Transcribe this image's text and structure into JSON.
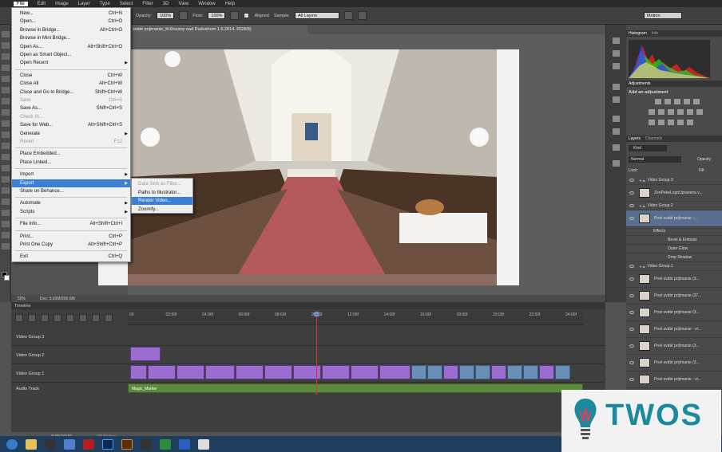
{
  "menubar": {
    "items": [
      "File",
      "Edit",
      "Image",
      "Layer",
      "Type",
      "Select",
      "Filter",
      "3D",
      "View",
      "Window",
      "Help"
    ],
    "active": "File"
  },
  "options_bar": {
    "opacity_label": "Opacity:",
    "opacity_value": "100%",
    "flow_label": "Flow:",
    "flow_value": "100%",
    "aligned_label": "Aligned",
    "sample_label": "Sample:",
    "sample_value": "All Layers",
    "workspace_value": "Motion"
  },
  "document": {
    "tab_title": "svätě prijimanie_Križovany nad Dudvahom 1.6.2014, RGB/8)"
  },
  "file_menu": {
    "items": [
      {
        "label": "New...",
        "shortcut": "Ctrl+N"
      },
      {
        "label": "Open...",
        "shortcut": "Ctrl+O"
      },
      {
        "label": "Browse in Bridge...",
        "shortcut": "Alt+Ctrl+O"
      },
      {
        "label": "Browse in Mini Bridge...",
        "shortcut": ""
      },
      {
        "label": "Open As...",
        "shortcut": "Alt+Shift+Ctrl+O"
      },
      {
        "label": "Open as Smart Object...",
        "shortcut": ""
      },
      {
        "label": "Open Recent",
        "shortcut": "",
        "submenu": true
      },
      {
        "label": "Close",
        "shortcut": "Ctrl+W"
      },
      {
        "label": "Close All",
        "shortcut": "Alt+Ctrl+W"
      },
      {
        "label": "Close and Go to Bridge...",
        "shortcut": "Shift+Ctrl+W"
      },
      {
        "label": "Save",
        "shortcut": "Ctrl+S",
        "disabled": true
      },
      {
        "label": "Save As...",
        "shortcut": "Shift+Ctrl+S"
      },
      {
        "label": "Check In...",
        "shortcut": "",
        "disabled": true
      },
      {
        "label": "Save for Web...",
        "shortcut": "Alt+Shift+Ctrl+S"
      },
      {
        "label": "Generate",
        "shortcut": "",
        "submenu": true
      },
      {
        "label": "Revert",
        "shortcut": "F12",
        "disabled": true
      },
      {
        "label": "Place Embedded...",
        "shortcut": ""
      },
      {
        "label": "Place Linked...",
        "shortcut": ""
      },
      {
        "label": "Import",
        "shortcut": "",
        "submenu": true
      },
      {
        "label": "Export",
        "shortcut": "",
        "submenu": true,
        "highlighted": true
      },
      {
        "label": "Share on Behance...",
        "shortcut": ""
      },
      {
        "label": "Automate",
        "shortcut": "",
        "submenu": true
      },
      {
        "label": "Scripts",
        "shortcut": "",
        "submenu": true
      },
      {
        "label": "File Info...",
        "shortcut": "Alt+Shift+Ctrl+I"
      },
      {
        "label": "Print...",
        "shortcut": "Ctrl+P"
      },
      {
        "label": "Print One Copy",
        "shortcut": "Alt+Shift+Ctrl+P"
      },
      {
        "label": "Exit",
        "shortcut": "Ctrl+Q"
      }
    ]
  },
  "export_submenu": {
    "items": [
      {
        "label": "Data Sets as Files...",
        "disabled": true
      },
      {
        "label": "Paths to Illustrator..."
      },
      {
        "label": "Render Video...",
        "highlighted": true
      },
      {
        "label": "Zoomify..."
      }
    ]
  },
  "status": {
    "zoom": "50%",
    "doc": "Doc: 5.93M/200.6M"
  },
  "panels": {
    "histogram_tab": "Histogram",
    "info_tab": "Info",
    "adjustments_tab": "Adjustments",
    "add_adjustment": "Add an adjustment",
    "layers_tab": "Layers",
    "channels_tab": "Channels",
    "kind_filter": "Kind",
    "blend_mode": "Normal",
    "opacity_label": "Opacity:",
    "opacity_value": "100%",
    "lock_label": "Lock:",
    "fill_label": "Fill:",
    "fill_value": "100%"
  },
  "layers": [
    {
      "name": "Video Group 3",
      "type": "group"
    },
    {
      "name": "ZenPekeLogoUpravena v...",
      "type": "layer"
    },
    {
      "name": "Video Group 2",
      "type": "group"
    },
    {
      "name": "Prvé sväté prijímanie -...",
      "type": "layer",
      "selected": true
    },
    {
      "name": "Effects",
      "type": "fx"
    },
    {
      "name": "Bevel & Emboss",
      "type": "fx"
    },
    {
      "name": "Outer Glow",
      "type": "fx"
    },
    {
      "name": "Drop Shadow",
      "type": "fx"
    },
    {
      "name": "Video Group 1",
      "type": "group"
    },
    {
      "name": "Prvé sväté prijímanie (3...",
      "type": "layer"
    },
    {
      "name": "Prvé sväté prijímanie (37...",
      "type": "layer"
    },
    {
      "name": "Prvé sväté prijímanie (3...",
      "type": "layer"
    },
    {
      "name": "Prvé sväté prijímanie - vi...",
      "type": "layer"
    },
    {
      "name": "Prvé sväté prijímanie (3...",
      "type": "layer"
    },
    {
      "name": "Prvé sväté prijímanie (3...",
      "type": "layer"
    },
    {
      "name": "Prvé sväté prijímanie - vi...",
      "type": "layer"
    },
    {
      "name": "Prvé sväté prijímanie (3...",
      "type": "layer"
    }
  ],
  "timeline": {
    "title": "Timeline",
    "ticks": [
      "00",
      "02:00f",
      "04:00f",
      "06:00f",
      "08:00f",
      "10:00f",
      "12:00f",
      "14:00f",
      "16:00f",
      "18:00f",
      "20:00f",
      "22:00f",
      "24:00f"
    ],
    "tracks": [
      "Video Group 3",
      "Video Group 2",
      "Video Group 1",
      "Audio Track"
    ],
    "audio_clip": "Magic_Marker",
    "timecode": "0:00:10:10",
    "fps": "(30.00 fps)"
  },
  "logo": {
    "text": "TWOS"
  },
  "colors": {
    "accent": "#3b7ed6",
    "video_clip": "#9b6dd0",
    "audio_clip": "#5c8b3c",
    "logo": "#1c8a9e",
    "playhead": "#dd3333"
  }
}
